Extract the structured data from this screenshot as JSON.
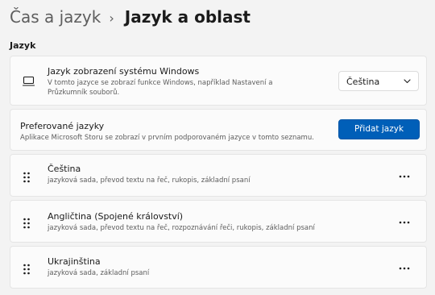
{
  "breadcrumb": {
    "parent": "Čas a jazyk",
    "separator": "›",
    "current": "Jazyk a oblast"
  },
  "section": {
    "label": "Jazyk"
  },
  "display_language": {
    "icon": "monitor-icon",
    "title": "Jazyk zobrazení systému Windows",
    "description": "V tomto jazyce se zobrazí funkce Windows, například Nastavení a Průzkumník souborů.",
    "selected": "Čeština",
    "dropdown_icon": "chevron-down-icon"
  },
  "preferred_languages": {
    "title": "Preferované jazyky",
    "description": "Aplikace Microsoft Storu se zobrazí v prvním podporovaném jazyce v tomto seznamu.",
    "add_button_label": "Přidat jazyk"
  },
  "languages": [
    {
      "name": "Čeština",
      "features": "jazyková sada, převod textu na řeč, rukopis, základní psaní"
    },
    {
      "name": "Angličtina (Spojené království)",
      "features": "jazyková sada, převod textu na řeč, rozpoznávání řeči, rukopis, základní psaní"
    },
    {
      "name": "Ukrajinština",
      "features": "jazyková sada, základní psaní"
    }
  ],
  "colors": {
    "accent": "#005fb8",
    "background": "#f3f3f3",
    "card": "#fbfbfb",
    "secondary_text": "#5d5d5d"
  }
}
